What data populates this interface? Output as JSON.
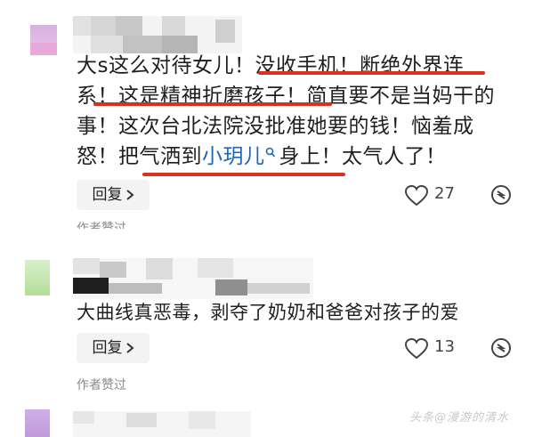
{
  "comments": [
    {
      "text_lines": [
        "大s这么对待女儿！没收手机！断绝外界连",
        "系！这是精神折磨孩子！简直要不是当妈干的",
        "事！这次台北法院没批准她要的钱！恼羞成"
      ],
      "last_line_before": "怒！把气洒到",
      "mention": "小玥儿",
      "last_line_after": "身上！太气人了！",
      "reply_label": "回复",
      "like_count": "27",
      "author_liked": "作者赞过"
    },
    {
      "text": "大曲线真恶毒，剥夺了奶奶和爸爸对孩子的爱",
      "reply_label": "回复",
      "like_count": "13",
      "author_liked": "作者赞过"
    }
  ],
  "watermark": "头条@漫游的清水",
  "colors": {
    "underline": "#d9311f",
    "mention": "#1a66b8",
    "avatar_pink": "#e0b7e6",
    "avatar_green": "#bfe3a8",
    "avatar_purple": "#c9a6e0"
  },
  "icons": [
    "heart-icon",
    "share-icon",
    "search-icon",
    "chevron-right-icon"
  ]
}
